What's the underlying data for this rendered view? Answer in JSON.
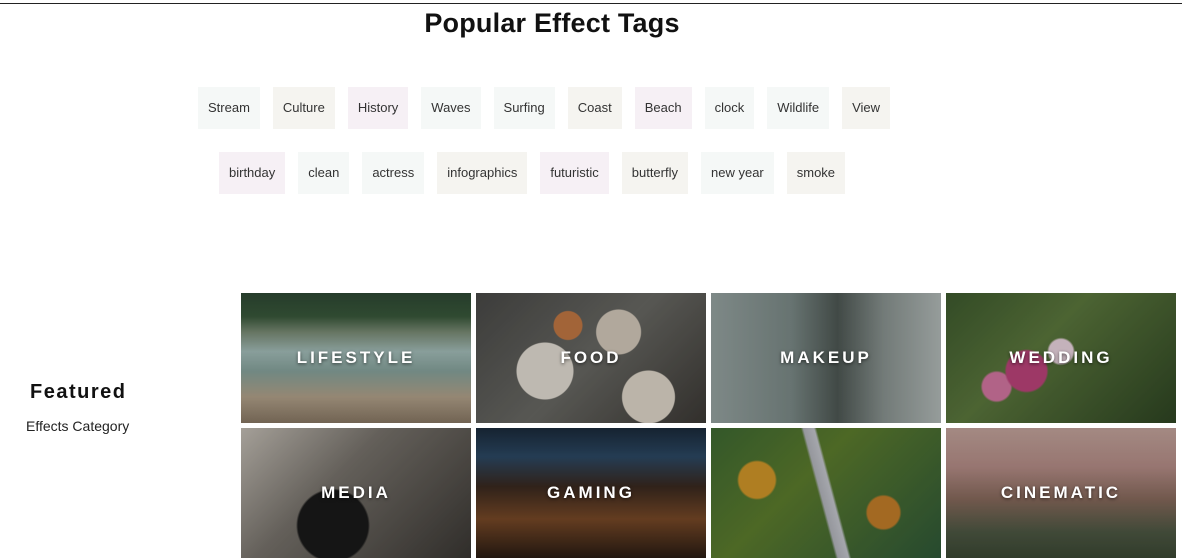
{
  "page": {
    "title": "Popular Effect Tags"
  },
  "tags": {
    "row1": [
      {
        "label": "Stream",
        "tone": "#f5f8f7"
      },
      {
        "label": "Culture",
        "tone": "#f5f4f0"
      },
      {
        "label": "History",
        "tone": "#f6f0f5"
      },
      {
        "label": "Waves",
        "tone": "#f5f8f7"
      },
      {
        "label": "Surfing",
        "tone": "#f5f8f7"
      },
      {
        "label": "Coast",
        "tone": "#f5f4f0"
      },
      {
        "label": "Beach",
        "tone": "#f6f0f5"
      },
      {
        "label": "clock",
        "tone": "#f5f8f7"
      },
      {
        "label": "Wildlife",
        "tone": "#f5f8f7"
      },
      {
        "label": "View",
        "tone": "#f5f4f0"
      }
    ],
    "row2": [
      {
        "label": "birthday",
        "tone": "#f6f0f5"
      },
      {
        "label": "clean",
        "tone": "#f5f8f7"
      },
      {
        "label": "actress",
        "tone": "#f5f8f7"
      },
      {
        "label": "infographics",
        "tone": "#f5f4f0"
      },
      {
        "label": "futuristic",
        "tone": "#f6f0f5"
      },
      {
        "label": "butterfly",
        "tone": "#f5f4f0"
      },
      {
        "label": "new year",
        "tone": "#f5f8f7"
      },
      {
        "label": "smoke",
        "tone": "#f5f4f0"
      }
    ]
  },
  "featured": {
    "heading": "Featured",
    "subheading": "Effects Category",
    "categories": [
      {
        "label": "LIFESTYLE",
        "image": "river-landscape"
      },
      {
        "label": "FOOD",
        "image": "food-table"
      },
      {
        "label": "MAKEUP",
        "image": "makeup-brushes"
      },
      {
        "label": "WEDDING",
        "image": "flower-bouquet"
      },
      {
        "label": "MEDIA",
        "image": "video-camera"
      },
      {
        "label": "GAMING",
        "image": "gaming-desk"
      },
      {
        "label": "",
        "image": "autumn-forest-road"
      },
      {
        "label": "CINEMATIC",
        "image": "cinematic-landscape"
      }
    ]
  }
}
